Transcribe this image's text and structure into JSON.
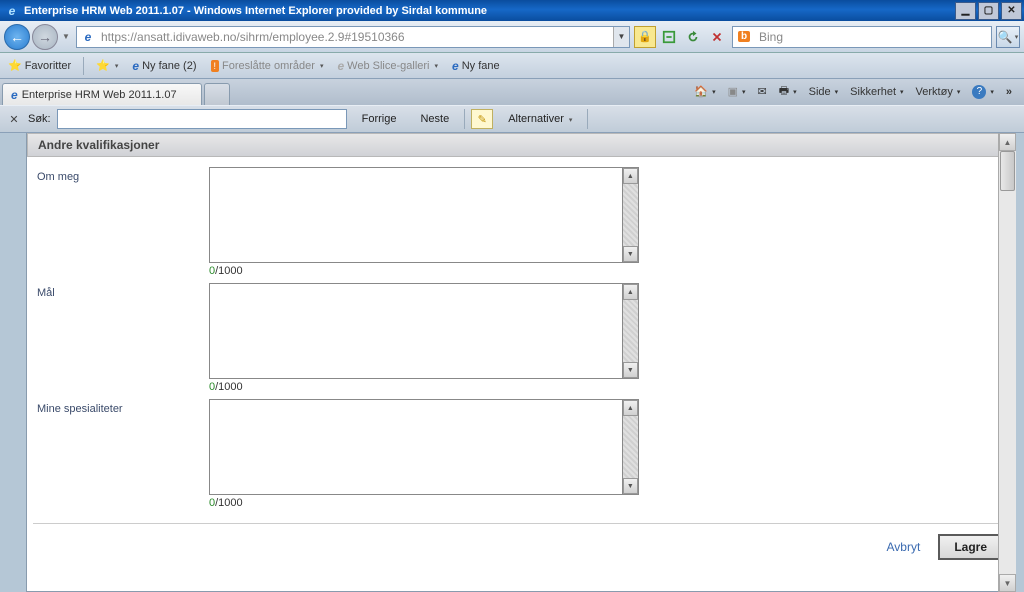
{
  "titlebar": {
    "text": "Enterprise HRM Web 2011.1.07 - Windows Internet Explorer provided by Sirdal kommune"
  },
  "nav": {
    "url_display": "https://ansatt.idivaweb.no/sihrm/employee.2.9#19510366",
    "search_placeholder": "Bing"
  },
  "favbar": {
    "favoritter": "Favoritter",
    "nyfane2": "Ny fane (2)",
    "foreslatte": "Foreslåtte områder",
    "webslice": "Web Slice-galleri",
    "nyfane": "Ny fane"
  },
  "tabs": {
    "active": "Enterprise HRM Web 2011.1.07"
  },
  "tabtools": {
    "side": "Side",
    "sikkerhet": "Sikkerhet",
    "verktoy": "Verktøy"
  },
  "findbar": {
    "label": "Søk:",
    "forrige": "Forrige",
    "neste": "Neste",
    "alternativer": "Alternativer"
  },
  "form": {
    "section_title": "Andre kvalifikasjoner",
    "fields": [
      {
        "label": "Om meg",
        "count": "0",
        "max": "/1000"
      },
      {
        "label": "Mål",
        "count": "0",
        "max": "/1000"
      },
      {
        "label": "Mine spesialiteter",
        "count": "0",
        "max": "/1000"
      }
    ],
    "cancel": "Avbryt",
    "save": "Lagre"
  }
}
